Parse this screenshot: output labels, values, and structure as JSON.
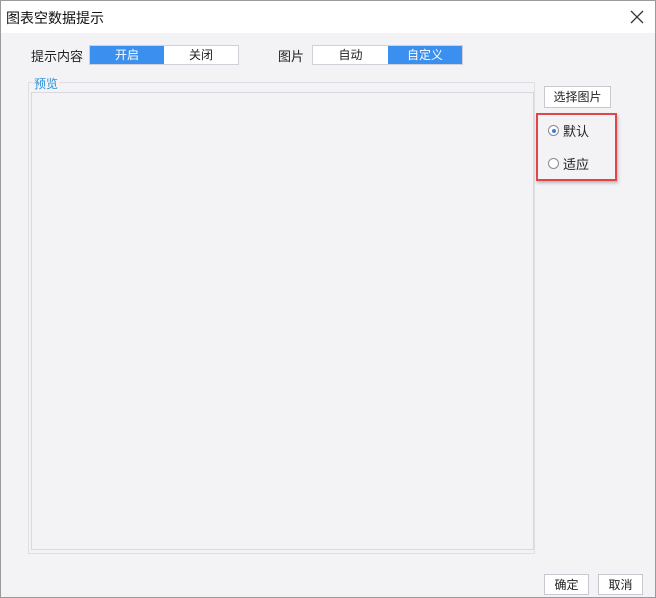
{
  "window": {
    "title": "图表空数据提示"
  },
  "content_row": {
    "label": "提示内容",
    "options": [
      "开启",
      "关闭"
    ],
    "selected": "开启"
  },
  "image_row": {
    "label": "图片",
    "options": [
      "自动",
      "自定义"
    ],
    "selected": "自定义"
  },
  "preview": {
    "label": "预览"
  },
  "select_image_button": "选择图片",
  "fit_options": {
    "items": [
      "默认",
      "适应"
    ],
    "selected": "默认",
    "highlight_color": "#e0454a"
  },
  "footer": {
    "ok": "确定",
    "cancel": "取消"
  },
  "colors": {
    "accent": "#3b8fee",
    "background": "#f3f3f6"
  },
  "icons": {
    "close": "close-icon"
  }
}
